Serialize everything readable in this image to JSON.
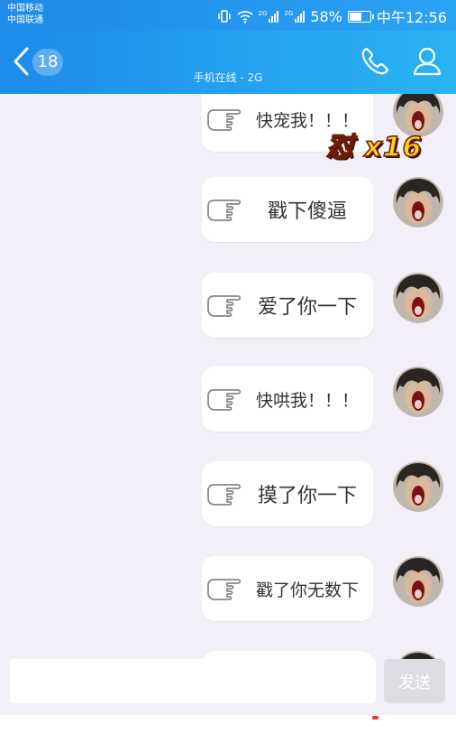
{
  "status_bar": {
    "carrier_1": "中国移动",
    "carrier_2": "中国联通",
    "net_1": "2G",
    "net_2": "2G",
    "battery": "58%",
    "battery_level": 0.58,
    "time": "中午12:56"
  },
  "header": {
    "unread_count": "18",
    "subtitle": "手机在线 - 2G"
  },
  "combo": "怼 x16",
  "messages": [
    {
      "text": "快宠我！！！",
      "type": "poke"
    },
    {
      "text": "戳下傻逼",
      "type": "poke"
    },
    {
      "text": "爱了你一下",
      "type": "poke"
    },
    {
      "text": "快哄我！！！",
      "type": "poke"
    },
    {
      "text": "摸了你一下",
      "type": "poke"
    },
    {
      "text": "戳了你无数下",
      "type": "poke"
    }
  ],
  "input": {
    "placeholder": "",
    "send_label": "发送"
  },
  "colors": {
    "header_start": "#1e8bea",
    "header_end": "#2ab3f4",
    "chat_bg": "#f3eff8",
    "send_disabled": "#dcdde2"
  }
}
